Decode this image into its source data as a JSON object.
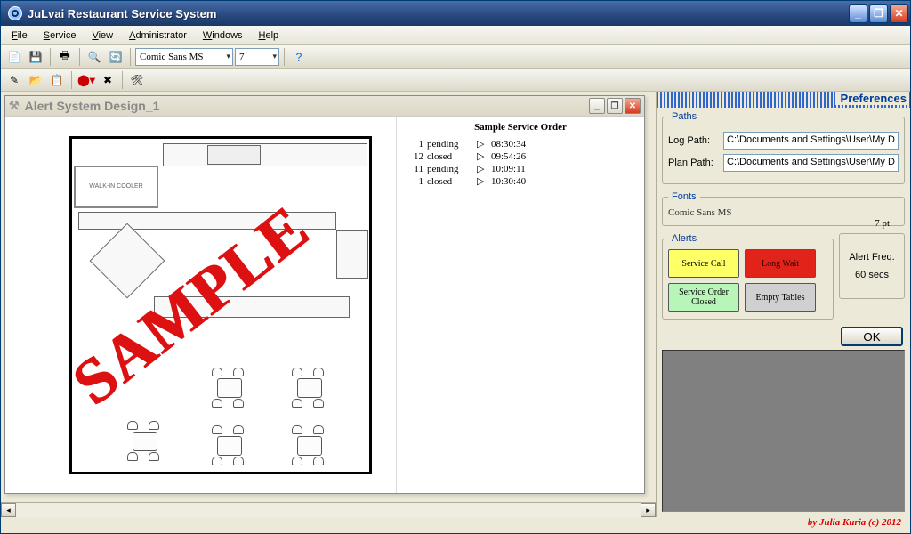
{
  "window": {
    "title": "JuLvai Restaurant Service System"
  },
  "menu": {
    "file": "File",
    "service": "Service",
    "view": "View",
    "administrator": "Administrator",
    "windows": "Windows",
    "help": "Help"
  },
  "toolbar": {
    "font_name": "Comic Sans MS",
    "font_size": "7"
  },
  "child": {
    "title": "Alert System Design_1",
    "watermark": "SAMPLE",
    "cooler_label": "WALK-IN COOLER"
  },
  "order_panel": {
    "title": "Sample Service Order",
    "rows": [
      {
        "id": "1",
        "status": "pending",
        "arrow": "▷",
        "time": "08:30:34"
      },
      {
        "id": "12",
        "status": "closed",
        "arrow": "▷",
        "time": "09:54:26"
      },
      {
        "id": "11",
        "status": "pending",
        "arrow": "▷",
        "time": "10:09:11"
      },
      {
        "id": "1",
        "status": "closed",
        "arrow": "▷",
        "time": "10:30:40"
      }
    ]
  },
  "preferences": {
    "title": "Preferences",
    "paths": {
      "legend": "Paths",
      "log_label": "Log Path:",
      "log_value": "C:\\Documents and Settings\\User\\My D",
      "plan_label": "Plan Path:",
      "plan_value": "C:\\Documents and Settings\\User\\My D"
    },
    "fonts": {
      "legend": "Fonts",
      "name": "Comic Sans MS",
      "size": "7 pt"
    },
    "alerts": {
      "legend": "Alerts",
      "service_call": "Service Call",
      "long_wait": "Long Wait",
      "order_closed": "Service Order Closed",
      "empty_tables": "Empty Tables",
      "freq_label": "Alert Freq.",
      "freq_value": "60 secs"
    },
    "ok": "OK"
  },
  "footer": "by Julia Kuria (c) 2012"
}
